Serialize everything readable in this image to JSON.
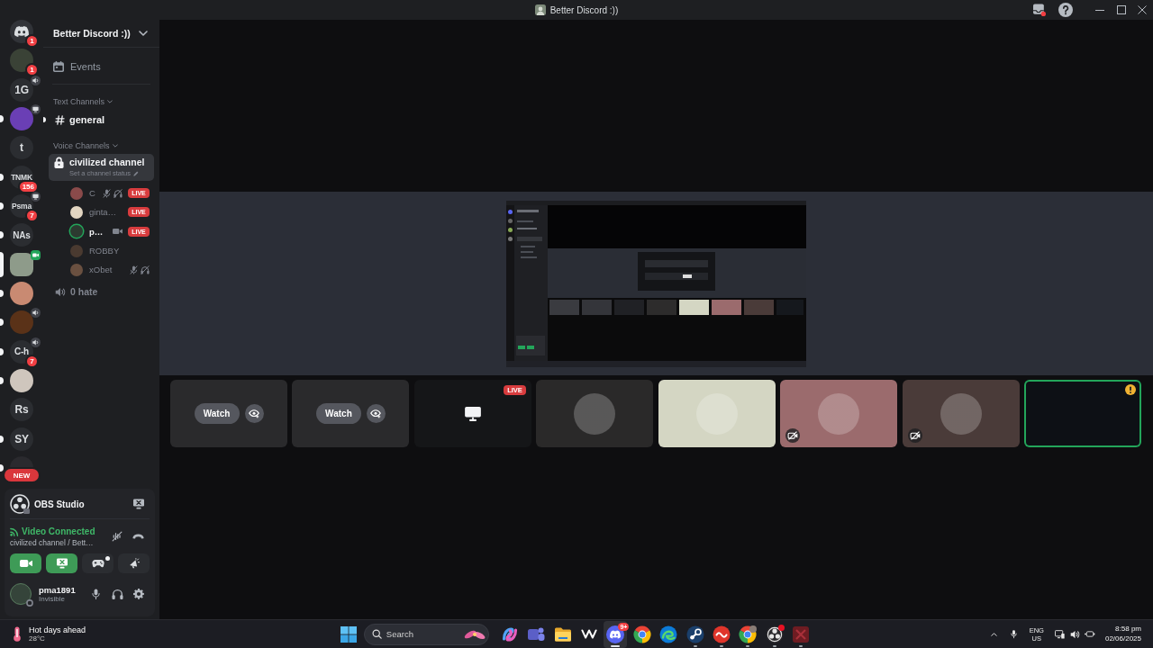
{
  "window": {
    "title": "Better Discord :))"
  },
  "server_rail": [
    {
      "kind": "home",
      "badge": "1",
      "unread": false,
      "selected": false,
      "in_voice": false,
      "sharing_screen": false,
      "on_camera": false
    },
    {
      "kind": "image",
      "color": "#3a4236",
      "badge": "1",
      "unread": false,
      "selected": false,
      "in_voice": false,
      "sharing_screen": false,
      "on_camera": false
    },
    {
      "kind": "text",
      "label": "1G",
      "unread": false,
      "selected": false,
      "in_voice": true,
      "sharing_screen": false,
      "on_camera": false
    },
    {
      "kind": "image",
      "color": "#6a3fb5",
      "unread": true,
      "selected": false,
      "in_voice": false,
      "sharing_screen": true,
      "on_camera": false
    },
    {
      "kind": "text",
      "label": "t",
      "unread": false,
      "selected": false,
      "in_voice": false,
      "sharing_screen": false,
      "on_camera": false
    },
    {
      "kind": "text",
      "label": "TNMK",
      "badge": "156",
      "unread": true,
      "selected": false,
      "in_voice": false,
      "sharing_screen": false,
      "on_camera": false
    },
    {
      "kind": "text",
      "label": "Psma",
      "badge": "7",
      "unread": true,
      "selected": false,
      "in_voice": false,
      "sharing_screen": true,
      "on_camera": false
    },
    {
      "kind": "text",
      "label": "NAs",
      "unread": true,
      "selected": false,
      "in_voice": false,
      "sharing_screen": false,
      "on_camera": false
    },
    {
      "kind": "image",
      "color": "#8e9b8a",
      "selected": true,
      "in_voice": false,
      "sharing_screen": false,
      "on_camera": true
    },
    {
      "kind": "image",
      "color": "#c98a72",
      "unread": true,
      "selected": false,
      "in_voice": false,
      "sharing_screen": false,
      "on_camera": false
    },
    {
      "kind": "image",
      "color": "#5a3218",
      "unread": true,
      "selected": false,
      "in_voice": true,
      "sharing_screen": false,
      "on_camera": false
    },
    {
      "kind": "text",
      "label": "C-h",
      "badge": "7",
      "unread": true,
      "selected": false,
      "in_voice": true,
      "sharing_screen": false,
      "on_camera": false
    },
    {
      "kind": "image",
      "color": "#cfc6bd",
      "unread": true,
      "selected": false,
      "in_voice": false,
      "sharing_screen": false,
      "on_camera": false
    },
    {
      "kind": "text",
      "label": "Rs",
      "unread": false,
      "selected": false,
      "in_voice": false,
      "sharing_screen": false,
      "on_camera": false
    },
    {
      "kind": "text",
      "label": "SY",
      "unread": true,
      "selected": false,
      "in_voice": false,
      "sharing_screen": false,
      "on_camera": false
    },
    {
      "kind": "image",
      "color": "#2a2a2e",
      "unread": true,
      "selected": false,
      "in_voice": false,
      "sharing_screen": false,
      "on_camera": false
    }
  ],
  "new_badge": "NEW",
  "sidebar": {
    "server_name": "Better Discord :))",
    "events": "Events",
    "categories": [
      {
        "name": "Text Channels",
        "channels": [
          {
            "kind": "text",
            "name": "general",
            "unread": true,
            "selected": false
          }
        ]
      },
      {
        "name": "Voice Channels",
        "channels": [
          {
            "kind": "voice",
            "name": "civilized channel",
            "locked": true,
            "selected": true,
            "status_placeholder": "Set a channel status",
            "members": [
              {
                "name": "C",
                "color": "#8a4a4a",
                "speaking": false,
                "muted": true,
                "deafened": true,
                "video": false,
                "live": "LIVE"
              },
              {
                "name": "ginta…",
                "color": "#e3d6c2",
                "speaking": false,
                "muted": false,
                "deafened": false,
                "video": false,
                "live": "LIVE"
              },
              {
                "name": "p…",
                "color": "#2c3a30",
                "speaking": true,
                "muted": false,
                "deafened": false,
                "video": true,
                "live": "LIVE"
              },
              {
                "name": "ROBBY",
                "color": "#4a3a30",
                "speaking": false,
                "muted": false,
                "deafened": false,
                "video": false
              },
              {
                "name": "xObet",
                "color": "#6a5040",
                "speaking": false,
                "muted": true,
                "deafened": true,
                "video": false
              }
            ]
          },
          {
            "kind": "voice",
            "name": "0 hate",
            "locked": false,
            "selected": false
          }
        ]
      }
    ]
  },
  "voice_panel": {
    "stream_app": "OBS Studio",
    "status": "Video Connected",
    "channel": "civilized channel / Bett…",
    "controls": [
      {
        "kind": "camera",
        "on": true,
        "dot": false
      },
      {
        "kind": "screen",
        "on": true,
        "dot": false
      },
      {
        "kind": "activity",
        "on": false,
        "dot": true
      },
      {
        "kind": "soundboard",
        "on": false,
        "dot": false
      }
    ],
    "user": {
      "name": "pma1891",
      "status": "Invisible"
    }
  },
  "stage": {
    "tiles": [
      {
        "kind": "stream",
        "watch": "Watch",
        "speaking": false,
        "video_off": false,
        "warning": false
      },
      {
        "kind": "stream",
        "watch": "Watch",
        "speaking": false,
        "video_off": false,
        "warning": false
      },
      {
        "kind": "screen",
        "live": "LIVE",
        "speaking": false,
        "video_off": false,
        "warning": false
      },
      {
        "kind": "avatar",
        "color": "#2a2929",
        "speaking": false,
        "video_off": false,
        "warning": false
      },
      {
        "kind": "avatar",
        "color": "#d4d6c3",
        "speaking": false,
        "video_off": false,
        "warning": false
      },
      {
        "kind": "avatar",
        "color": "#9b6b6d",
        "speaking": false,
        "video_off": true,
        "warning": false
      },
      {
        "kind": "avatar",
        "color": "#4a3b39",
        "speaking": false,
        "video_off": true,
        "warning": false
      },
      {
        "kind": "camera",
        "speaking": true,
        "video_off": false,
        "warning": true
      }
    ]
  },
  "taskbar": {
    "weather": {
      "title": "Hot days ahead",
      "temperature": "28°C"
    },
    "search": {
      "placeholder": "Search"
    },
    "apps": [
      {
        "kind": "swirl",
        "open": false,
        "focused": false,
        "alert": false
      },
      {
        "kind": "people",
        "open": false,
        "focused": false,
        "alert": false
      },
      {
        "kind": "folder",
        "open": false,
        "focused": false,
        "alert": false
      },
      {
        "kind": "zigzag",
        "open": false,
        "focused": false,
        "alert": false
      },
      {
        "kind": "logo",
        "open": true,
        "focused": true,
        "alert": false,
        "badge": "9+"
      },
      {
        "kind": "ring",
        "open": false,
        "focused": false,
        "alert": false
      },
      {
        "kind": "wave",
        "open": false,
        "focused": false,
        "alert": false
      },
      {
        "kind": "rod",
        "open": true,
        "focused": false,
        "alert": false
      },
      {
        "kind": "disc",
        "open": true,
        "focused": false,
        "alert": false
      },
      {
        "kind": "ring_profile",
        "open": true,
        "focused": false,
        "alert": false
      },
      {
        "kind": "dots_ring",
        "open": true,
        "focused": false,
        "alert": true
      },
      {
        "kind": "square",
        "open": true,
        "focused": false,
        "alert": false
      }
    ],
    "tray": {
      "language": "ENG",
      "region": "US",
      "time": "8:58 pm",
      "date": "02/06/2025"
    }
  }
}
